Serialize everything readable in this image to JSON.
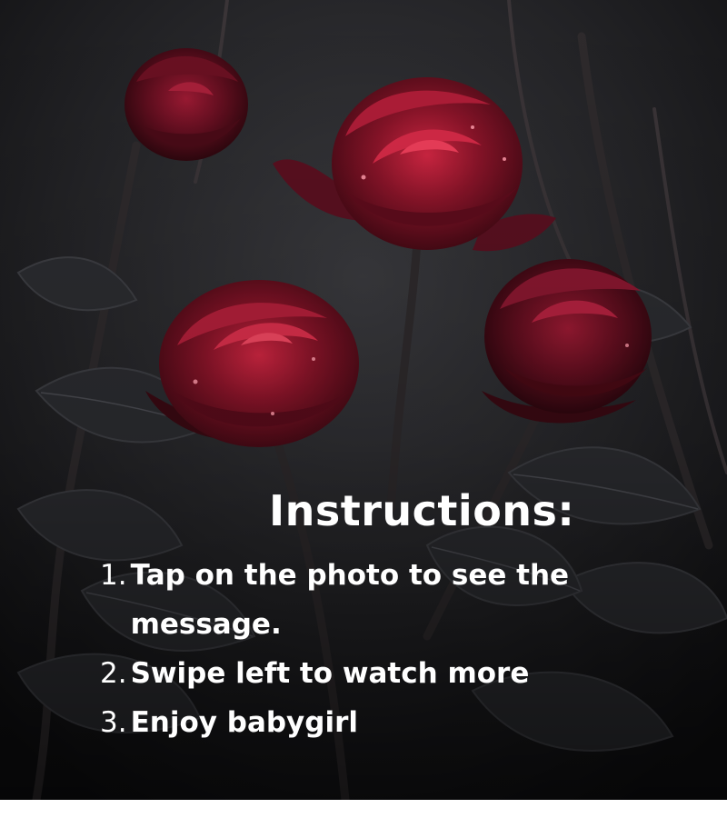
{
  "title": "Instructions:",
  "instructions": [
    {
      "number": "1.",
      "text": "Tap on the photo  to see the message."
    },
    {
      "number": "2.",
      "text": "Swipe left to watch more"
    },
    {
      "number": "3.",
      "text": " Enjoy babygirl"
    }
  ],
  "colors": {
    "background": "#1b1b1d",
    "rose": "#7a1226",
    "rose_highlight": "#c0213a",
    "leaf": "#2a2b2e",
    "text": "#ffffff"
  }
}
